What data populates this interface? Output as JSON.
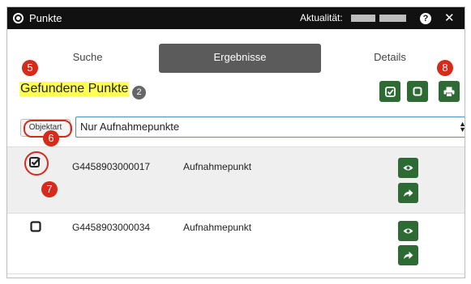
{
  "window": {
    "title": "Punkte",
    "aktualitaet_label": "Aktualität:",
    "help_glyph": "?",
    "close_glyph": "✕"
  },
  "tabs": [
    {
      "label": "Suche",
      "active": false
    },
    {
      "label": "Ergebnisse",
      "active": true
    },
    {
      "label": "Details",
      "active": false
    }
  ],
  "results": {
    "title": "Gefundene Punkte",
    "count": "2",
    "filter_label": "Objektart",
    "filter_value": "Nur Aufnahmepunkte"
  },
  "rows": [
    {
      "id": "G4458903000017",
      "type": "Aufnahmepunkt",
      "checked": true
    },
    {
      "id": "G4458903000034",
      "type": "Aufnahmepunkt",
      "checked": false
    }
  ],
  "annotations": [
    "5",
    "6",
    "7",
    "8"
  ],
  "colors": {
    "accent_green": "#2e6b34",
    "marker_red": "#d62a1a",
    "highlight": "#ffff55"
  },
  "icons": [
    "check-all-icon",
    "uncheck-all-icon",
    "print-icon",
    "eye-icon",
    "share-arrow-icon"
  ]
}
